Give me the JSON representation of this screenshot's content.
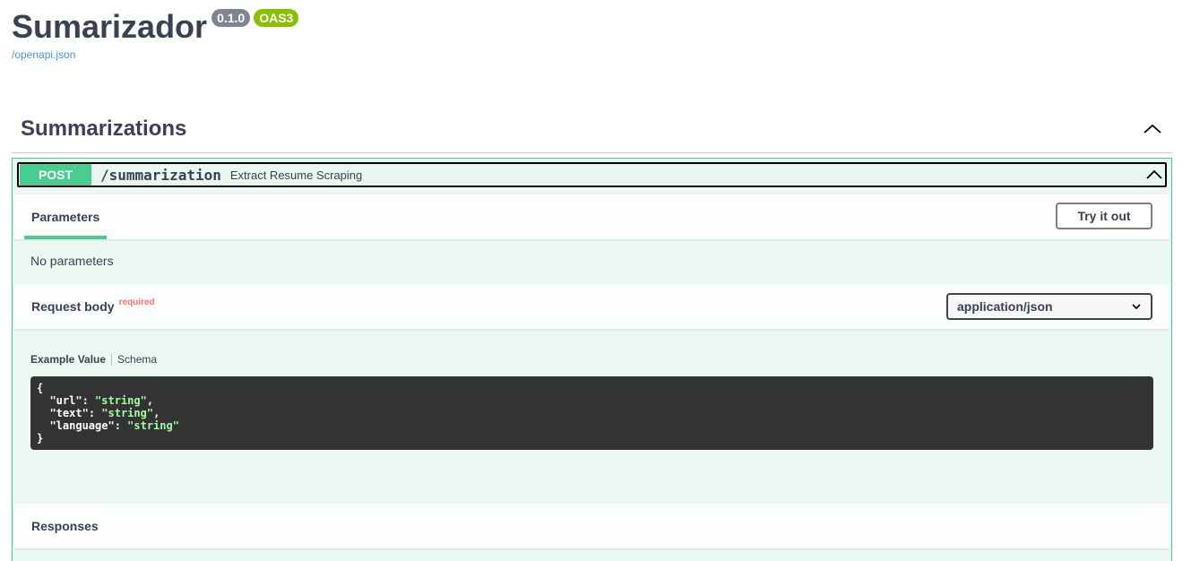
{
  "info": {
    "title": "Sumarizador",
    "version": "0.1.0",
    "oas": "OAS3",
    "spec_link": "/openapi.json"
  },
  "tag": {
    "name": "Summarizations"
  },
  "operation": {
    "method": "POST",
    "path": "/summarization",
    "summary": "Extract Resume Scraping",
    "parameters_tab": "Parameters",
    "try_button": "Try it out",
    "no_params": "No parameters",
    "request_body_label": "Request body",
    "required_label": "required",
    "content_type": "application/json",
    "example_tab": "Example Value",
    "schema_tab": "Schema",
    "example": {
      "open": "{",
      "close": "}",
      "fields": [
        {
          "key": "\"url\"",
          "value": "\"string\"",
          "sep": ","
        },
        {
          "key": "\"text\"",
          "value": "\"string\"",
          "sep": ","
        },
        {
          "key": "\"language\"",
          "value": "\"string\"",
          "sep": ""
        }
      ]
    },
    "responses_label": "Responses"
  },
  "colors": {
    "post": "#49cc90",
    "version_badge": "#7d8492",
    "oas_badge": "#89bf04",
    "link": "#4990e2",
    "required": "#ff6f6f"
  }
}
